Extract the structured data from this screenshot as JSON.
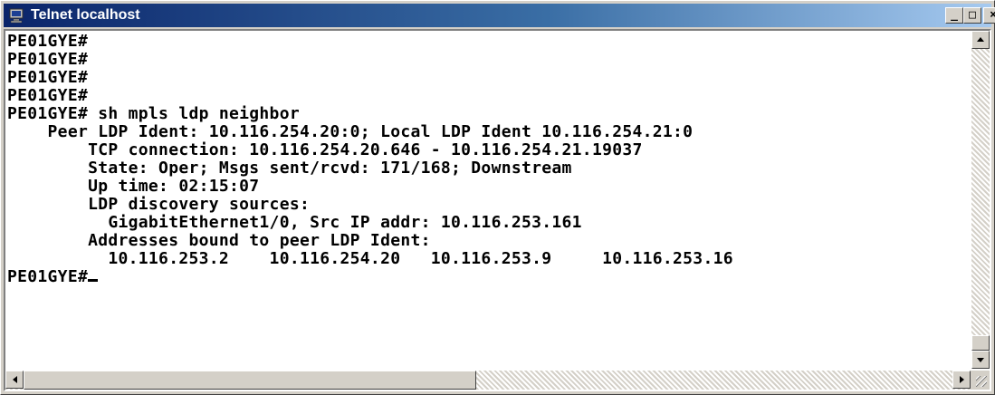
{
  "window": {
    "title": "Telnet localhost",
    "icon": "telnet-icon",
    "controls": {
      "minimize": "_",
      "maximize": "□",
      "close": "×"
    }
  },
  "terminal": {
    "lines": [
      "PE01GYE#",
      "PE01GYE#",
      "PE01GYE#",
      "PE01GYE#",
      "PE01GYE# sh mpls ldp neighbor",
      "    Peer LDP Ident: 10.116.254.20:0; Local LDP Ident 10.116.254.21:0",
      "        TCP connection: 10.116.254.20.646 - 10.116.254.21.19037",
      "        State: Oper; Msgs sent/rcvd: 171/168; Downstream",
      "        Up time: 02:15:07",
      "        LDP discovery sources:",
      "          GigabitEthernet1/0, Src IP addr: 10.116.253.161",
      "        Addresses bound to peer LDP Ident:",
      "          10.116.253.2    10.116.254.20   10.116.253.9     10.116.253.16"
    ],
    "prompt": "PE01GYE#"
  },
  "colors": {
    "titlebar_start": "#0a246a",
    "titlebar_end": "#a6caf0",
    "terminal_bg": "#ffffff",
    "terminal_text": "#000000"
  }
}
